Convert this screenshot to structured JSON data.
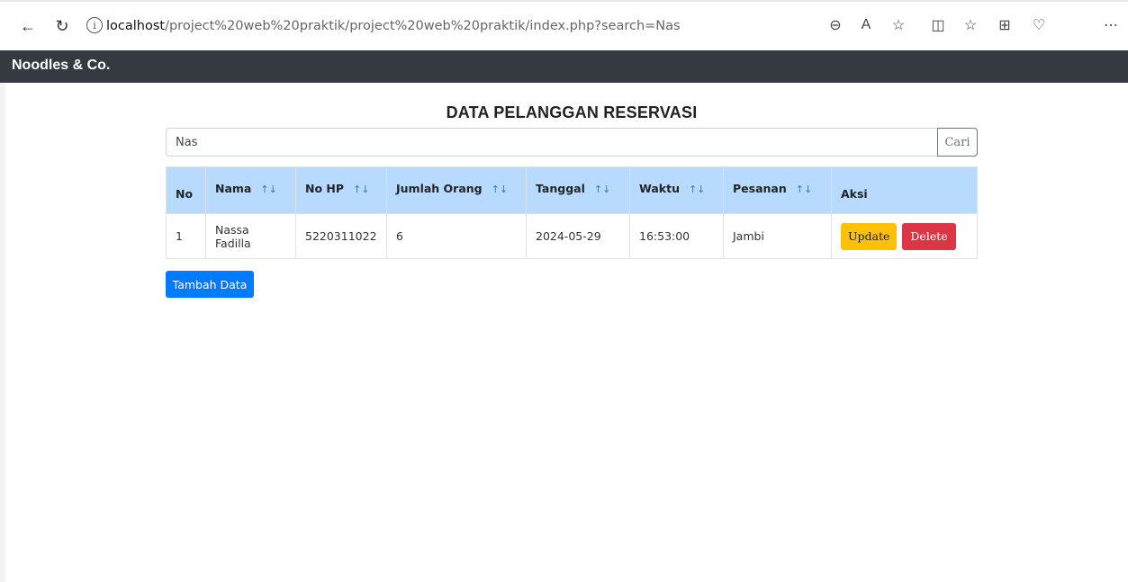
{
  "browser": {
    "url_host": "localhost",
    "url_path": "/project%20web%20praktik/project%20web%20praktik/index.php?search=Nas",
    "icons": [
      "back-icon",
      "refresh-icon",
      "info-icon",
      "zoom-out-icon",
      "read-aloud-icon",
      "favorite-star-icon",
      "split-screen-icon",
      "favorites-list-icon",
      "collections-icon",
      "health-icon",
      "more-icon"
    ]
  },
  "navbar": {
    "brand": "Noodles & Co."
  },
  "page": {
    "title": "DATA PELANGGAN RESERVASI"
  },
  "search": {
    "value": "Nas",
    "button_label": "Cari"
  },
  "table": {
    "headers": [
      {
        "label": "No",
        "sortable": false
      },
      {
        "label": "Nama",
        "sortable": true
      },
      {
        "label": "No HP",
        "sortable": true
      },
      {
        "label": "Jumlah Orang",
        "sortable": true
      },
      {
        "label": "Tanggal",
        "sortable": true
      },
      {
        "label": "Waktu",
        "sortable": true
      },
      {
        "label": "Pesanan",
        "sortable": true
      },
      {
        "label": "Aksi",
        "sortable": false
      }
    ],
    "sort_glyph": "↑↓",
    "rows": [
      {
        "no": "1",
        "nama": "Nassa Fadilla",
        "no_hp": "5220311022",
        "jumlah_orang": "6",
        "tanggal": "2024-05-29",
        "waktu": "16:53:00",
        "pesanan": "Jambi",
        "update_label": "Update",
        "delete_label": "Delete"
      }
    ]
  },
  "actions": {
    "add_label": "Tambah Data"
  },
  "colors": {
    "navbar": "#343a40",
    "table_header": "#b8daff",
    "update": "#ffc107",
    "delete": "#dc3545",
    "primary": "#007bff"
  }
}
